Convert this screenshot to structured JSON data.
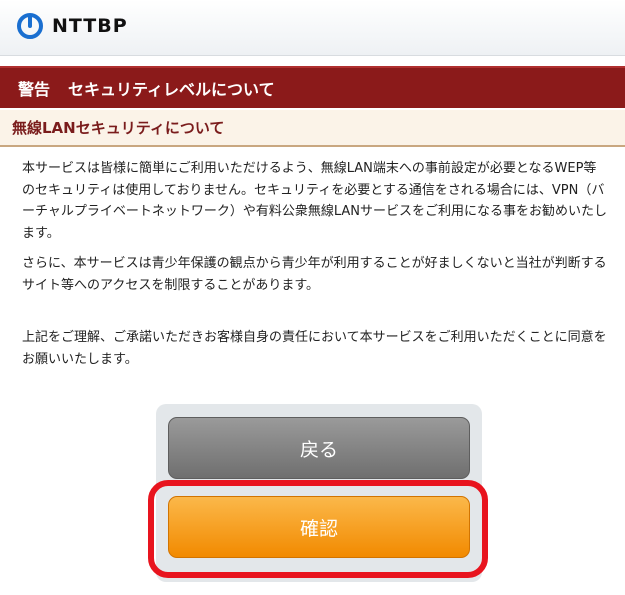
{
  "header": {
    "logo_text": "NTTBP",
    "logo_icon": "nttbp-logo-icon"
  },
  "warning": {
    "tag": "警告",
    "title": "セキュリティレベルについて"
  },
  "section": {
    "title": "無線LANセキュリティについて"
  },
  "content": {
    "paragraphs": [
      "本サービスは皆様に簡単にご利用いただけるよう、無線LAN端末への事前設定が必要となるWEP等のセキュリティは使用しておりません。セキュリティを必要とする通信をされる場合には、VPN（バーチャルプライベートネットワーク）や有料公衆無線LANサービスをご利用になる事をお勧めいたします。",
      "さらに、本サービスは青少年保護の観点から青少年が利用することが好ましくないと当社が判断するサイト等へのアクセスを制限することがあります。",
      "上記をご理解、ご承諾いただきお客様自身の責任において本サービスをご利用いただくことに同意をお願いいたします。"
    ]
  },
  "buttons": {
    "back_label": "戻る",
    "confirm_label": "確認"
  },
  "colors": {
    "warning_bar": "#8b1a1a",
    "section_text": "#7a1c1c",
    "confirm_button": "#f28a00",
    "back_button": "#7f7f7f",
    "highlight": "#e8141e",
    "logo": "#1a6fd0"
  }
}
